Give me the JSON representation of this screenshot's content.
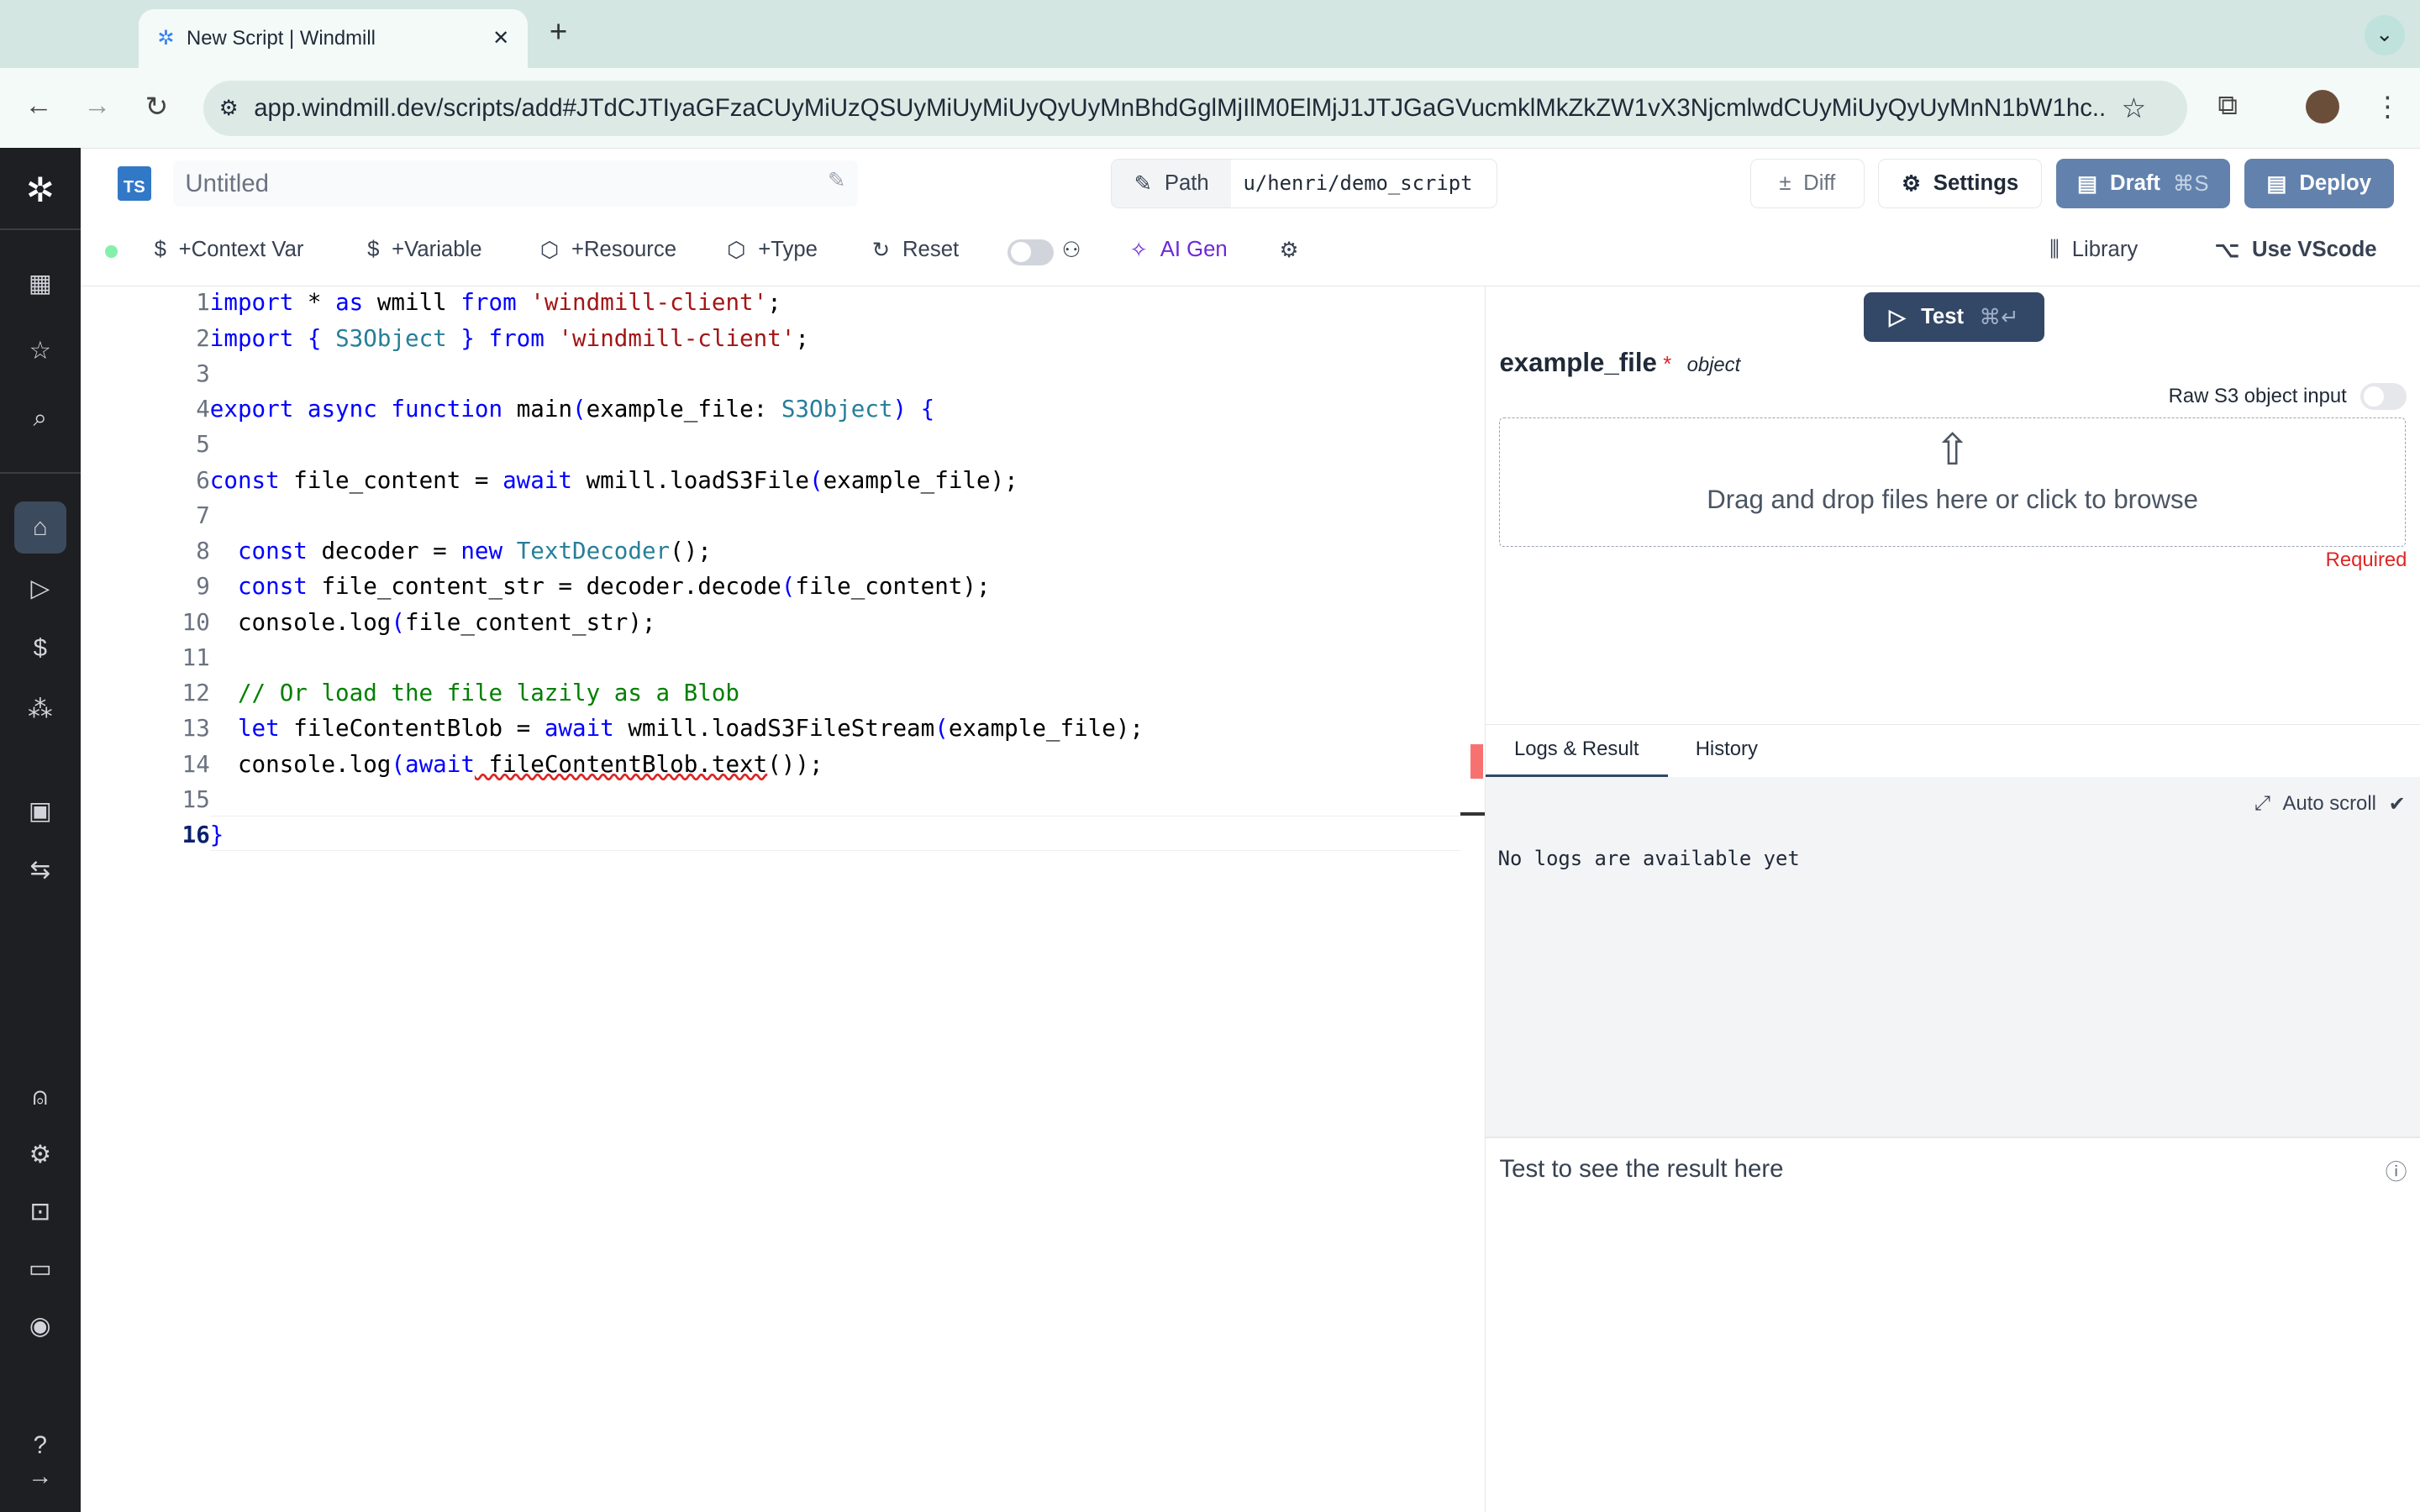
{
  "browser": {
    "tab_title": "New Script | Windmill",
    "new_tab": "+",
    "url": "app.windmill.dev/scripts/add#JTdCJTIyaGFzaCUyMiUzQSUyMiUyMiUyQyUyMnBhdGglMjIlM0ElMjJ1JTJGaGVucmklMkZkZW1vX3NjcmlwdCUyMiUyQyUyMnN1bW1hc..."
  },
  "header": {
    "lang_badge": "TS",
    "title_placeholder": "Untitled",
    "path_label": "Path",
    "path_value": "u/henri/demo_script",
    "diff": "Diff",
    "settings": "Settings",
    "draft": "Draft",
    "draft_shortcut": "⌘S",
    "deploy": "Deploy"
  },
  "toolbar": {
    "context_var": "+Context Var",
    "variable": "+Variable",
    "resource": "+Resource",
    "type": "+Type",
    "reset": "Reset",
    "ai_gen": "AI Gen",
    "library": "Library",
    "use_vscode": "Use VScode"
  },
  "editor": {
    "lines": [
      [
        [
          "import",
          "kw"
        ],
        [
          " * ",
          "pl"
        ],
        [
          "as",
          "kw"
        ],
        [
          " wmill ",
          "pl"
        ],
        [
          "from",
          "kw"
        ],
        [
          " ",
          "pl"
        ],
        [
          "'windmill-client'",
          "str"
        ],
        [
          ";",
          "pl"
        ]
      ],
      [
        [
          "import",
          "kw"
        ],
        [
          " { ",
          "kw"
        ],
        [
          "S3Object",
          "ty"
        ],
        [
          " } ",
          "kw"
        ],
        [
          "from",
          "kw"
        ],
        [
          " ",
          "pl"
        ],
        [
          "'windmill-client'",
          "str"
        ],
        [
          ";",
          "pl"
        ]
      ],
      [],
      [
        [
          "export",
          "kw"
        ],
        [
          " ",
          "pl"
        ],
        [
          "async",
          "kw"
        ],
        [
          " ",
          "pl"
        ],
        [
          "function",
          "kw"
        ],
        [
          " main",
          "pl"
        ],
        [
          "(",
          "kw"
        ],
        [
          "example_file: ",
          "pl"
        ],
        [
          "S3Object",
          "ty"
        ],
        [
          ") {",
          "kw"
        ]
      ],
      [],
      [
        [
          "const",
          "kw"
        ],
        [
          " file_content = ",
          "pl"
        ],
        [
          "await",
          "kw"
        ],
        [
          " wmill.loadS3File",
          "pl"
        ],
        [
          "(",
          "kw"
        ],
        [
          "example_file",
          "pl"
        ],
        [
          ");",
          "pl"
        ]
      ],
      [],
      [
        [
          "  ",
          "pl"
        ],
        [
          "const",
          "kw"
        ],
        [
          " decoder = ",
          "pl"
        ],
        [
          "new",
          "kw"
        ],
        [
          " ",
          "pl"
        ],
        [
          "TextDecoder",
          "ty"
        ],
        [
          "();",
          "pl"
        ]
      ],
      [
        [
          "  ",
          "pl"
        ],
        [
          "const",
          "kw"
        ],
        [
          " file_content_str = decoder.decode",
          "pl"
        ],
        [
          "(",
          "kw"
        ],
        [
          "file_content",
          "pl"
        ],
        [
          ");",
          "pl"
        ]
      ],
      [
        [
          "  console.log",
          "pl"
        ],
        [
          "(",
          "kw"
        ],
        [
          "file_content_str",
          "pl"
        ],
        [
          ");",
          "pl"
        ]
      ],
      [],
      [
        [
          "  // Or load the file lazily as a Blob",
          "cm"
        ]
      ],
      [
        [
          "  ",
          "pl"
        ],
        [
          "let",
          "kw"
        ],
        [
          " fileContentBlob = ",
          "pl"
        ],
        [
          "await",
          "kw"
        ],
        [
          " wmill.loadS3FileStream",
          "pl"
        ],
        [
          "(",
          "kw"
        ],
        [
          "example_file",
          "pl"
        ],
        [
          ");",
          "pl"
        ]
      ],
      [
        [
          "  console.log",
          "pl"
        ],
        [
          "(",
          "kw"
        ],
        [
          "await",
          "kw"
        ],
        [
          " fileContentBlob.text",
          "pl"
        ],
        [
          "());",
          "pl"
        ]
      ],
      [],
      [
        [
          "}",
          "kw"
        ]
      ]
    ]
  },
  "test": {
    "button": "Test",
    "shortcut": "⌘↵",
    "arg_name": "example_file",
    "required_mark": "*",
    "arg_type": "object",
    "raw_toggle": "Raw S3 object input",
    "dropzone": "Drag and drop files here or click to browse",
    "required": "Required"
  },
  "logs": {
    "tabs": [
      "Logs & Result",
      "History"
    ],
    "auto_scroll": "Auto scroll",
    "empty": "No logs are available yet",
    "result_hint": "Test to see the result here"
  },
  "colors": {
    "accent": "#6282ad",
    "test_button": "#334766",
    "sidebar": "#1e1f22",
    "ai": "#6d28d9"
  }
}
